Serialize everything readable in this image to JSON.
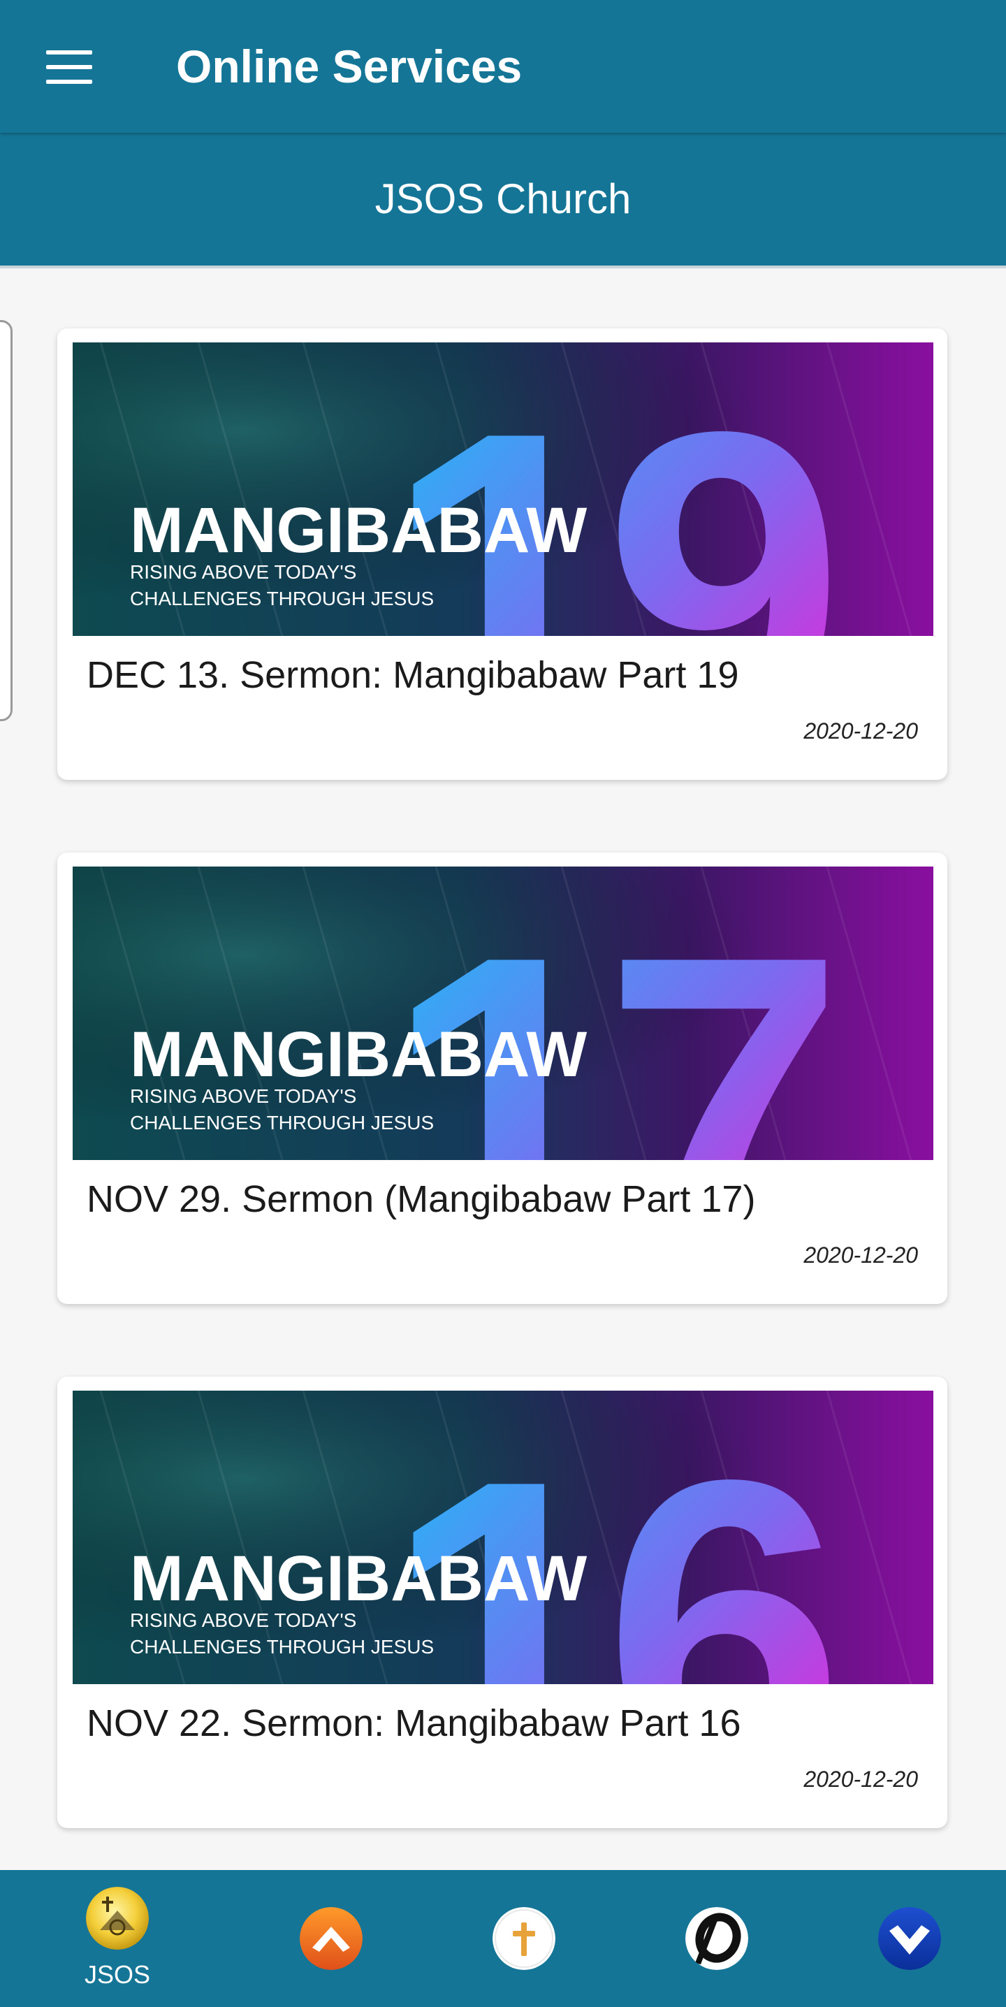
{
  "app_bar": {
    "title": "Online Services",
    "menu_icon": "hamburger-menu-icon",
    "color": "#147596"
  },
  "sub_header": {
    "title": "JSOS Church"
  },
  "feed": {
    "items": [
      {
        "thumbnail": {
          "brand": "MANGIBABAW",
          "tagline_line1": "RISING ABOVE TODAY'S",
          "tagline_line2": "CHALLENGES THROUGH JESUS",
          "number": "19"
        },
        "title": "DEC 13. Sermon: Mangibabaw Part 19",
        "date": "2020-12-20"
      },
      {
        "thumbnail": {
          "brand": "MANGIBABAW",
          "tagline_line1": "RISING ABOVE TODAY'S",
          "tagline_line2": "CHALLENGES THROUGH JESUS",
          "number": "17"
        },
        "title": "NOV 29. Sermon (Mangibabaw Part 17)",
        "date": "2020-12-20"
      },
      {
        "thumbnail": {
          "brand": "MANGIBABAW",
          "tagline_line1": "RISING ABOVE TODAY'S",
          "tagline_line2": "CHALLENGES THROUGH JESUS",
          "number": "16"
        },
        "title": "NOV 22. Sermon: Mangibabaw Part 16",
        "date": "2020-12-20"
      }
    ]
  },
  "bottom_nav": {
    "items": [
      {
        "label": "JSOS",
        "icon": "jsos-church-logo-icon",
        "selected": true
      },
      {
        "label": "",
        "icon": "orange-up-arrow-logo-icon",
        "selected": false
      },
      {
        "label": "",
        "icon": "cross-logo-icon",
        "selected": false
      },
      {
        "label": "",
        "icon": "o-logo-icon",
        "selected": false
      },
      {
        "label": "",
        "icon": "blue-chevron-down-icon",
        "selected": false
      }
    ]
  },
  "colors": {
    "primary": "#147596",
    "background": "#f6f6f6",
    "card": "#ffffff",
    "gradient_cyan": "#17c4f7",
    "gradient_magenta": "#ff16d0"
  }
}
